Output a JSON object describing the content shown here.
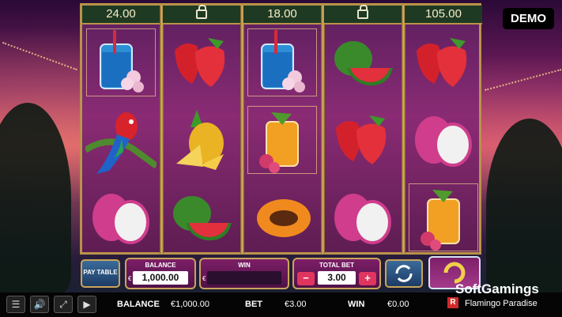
{
  "reels": {
    "top_values": [
      "24.00",
      "",
      "18.00",
      "",
      "105.00"
    ],
    "locked": [
      false,
      true,
      false,
      true,
      false
    ],
    "columns": [
      [
        "cocktail-icon",
        "parrot-icon",
        "dragonfruit-icon"
      ],
      [
        "strawberry-icon",
        "pineapple-icon",
        "watermelon-icon"
      ],
      [
        "cocktail-icon",
        "mai-tai-icon",
        "papaya-icon"
      ],
      [
        "watermelon-icon",
        "strawberry-icon",
        "dragonfruit-icon"
      ],
      [
        "strawberry-icon",
        "dragonfruit-icon",
        "mai-tai-icon"
      ]
    ]
  },
  "badge": {
    "demo": "DEMO"
  },
  "panel": {
    "paytable_label": "PAY TABLE",
    "balance_label": "BALANCE",
    "balance_value": "1,000.00",
    "win_label": "WIN",
    "win_value": "",
    "totalbet_label": "TOTAL BET",
    "totalbet_value": "3.00",
    "currency": "€",
    "minus": "−",
    "plus": "+"
  },
  "bottom": {
    "balance_label": "BALANCE",
    "balance_value": "€1,000.00",
    "bet_label": "BET",
    "bet_value": "€3.00",
    "win_label": "WIN",
    "win_value": "€0.00"
  },
  "branding": {
    "provider": "SoftGamings",
    "game_title": "Flamingo Paradise",
    "mark": "R"
  },
  "colors": {
    "frame_gold": "#b9934a",
    "panel_purple": "#7d1e68",
    "accent_pink": "#e0355f"
  }
}
